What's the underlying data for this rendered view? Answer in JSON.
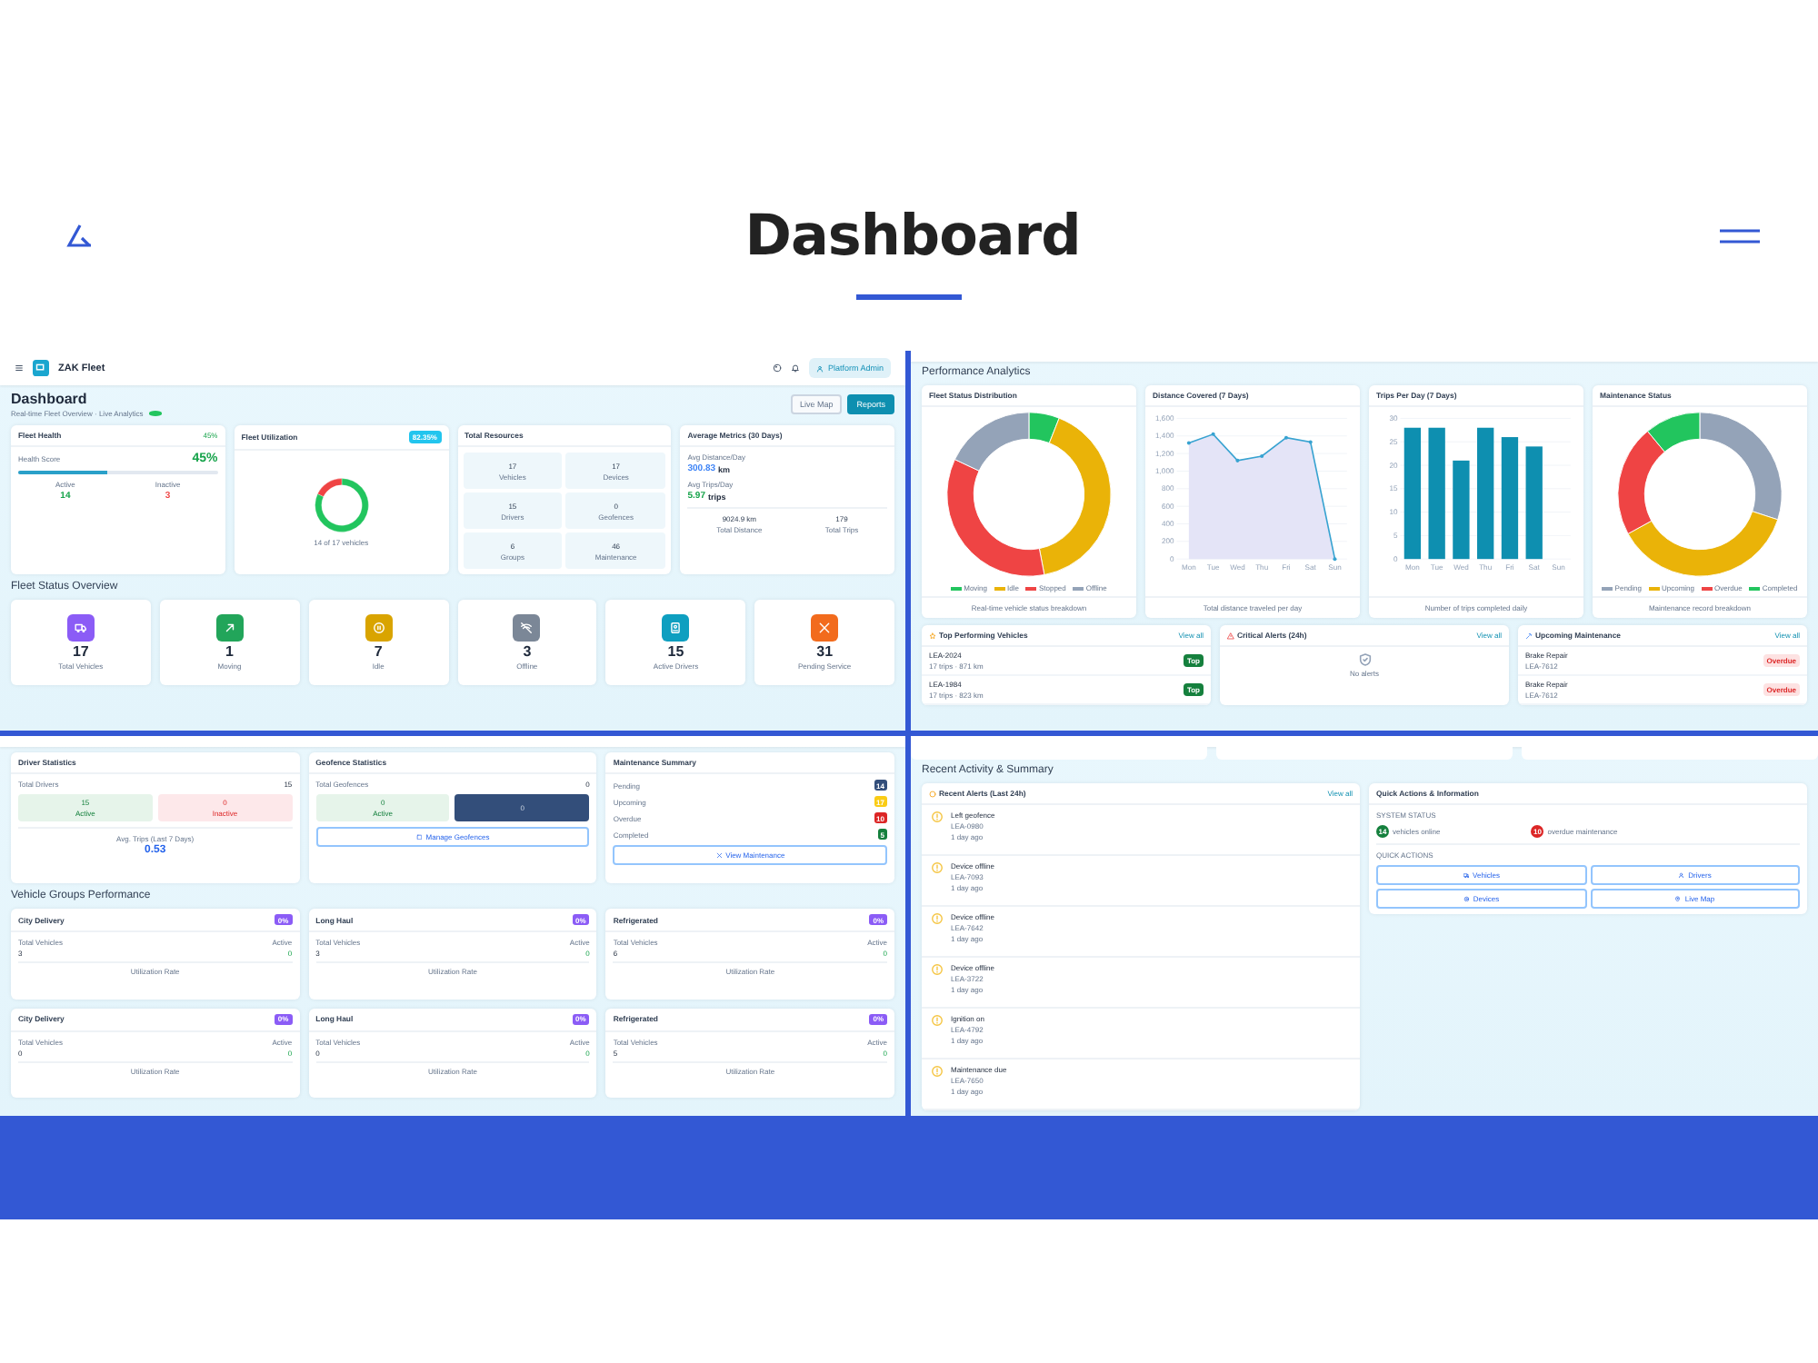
{
  "page": {
    "title": "Dashboard"
  },
  "app": {
    "brand": "ZAK Fleet",
    "user": "Platform Admin"
  },
  "overview": {
    "title": "Dashboard",
    "subtitle": "Real-time Fleet Overview · Live Analytics",
    "buttons": [
      {
        "label": "Live Map",
        "kind": "outline"
      },
      {
        "label": "Reports",
        "kind": "primary"
      }
    ],
    "fleet_health": {
      "title": "Fleet Health",
      "badge": "45%",
      "score_label": "Health Score",
      "score": "45%",
      "level": 0.45,
      "active_label": "Active",
      "active": "14",
      "inactive_label": "Inactive",
      "inactive": "3"
    },
    "utilization": {
      "title": "Fleet Utilization",
      "badge": "82.35%",
      "chart_data": {
        "type": "donut",
        "series": [
          {
            "values": [
              82,
              18
            ]
          }
        ],
        "colors": [
          "#22c55e",
          "#ef4444"
        ]
      },
      "caption": "14 of 17 vehicles"
    },
    "resources": {
      "title": "Total Resources",
      "items": [
        {
          "value": "17",
          "label": "Vehicles"
        },
        {
          "value": "17",
          "label": "Devices"
        },
        {
          "value": "15",
          "label": "Drivers"
        },
        {
          "value": "0",
          "label": "Geofences"
        },
        {
          "value": "6",
          "label": "Groups"
        },
        {
          "value": "46",
          "label": "Maintenance"
        }
      ]
    },
    "metrics": {
      "title": "Average Metrics (30 Days)",
      "items": [
        {
          "label": "Avg Distance/Day",
          "value": "300.83",
          "unit": "km",
          "color": "#3b82f6"
        },
        {
          "label": "Avg Trips/Day",
          "value": "5.97",
          "unit": "trips",
          "color": "#16a34a"
        }
      ],
      "totals": [
        {
          "value": "9024.9 km",
          "label": "Total Distance"
        },
        {
          "value": "179",
          "label": "Total Trips"
        }
      ]
    },
    "status_heading": "Fleet Status Overview",
    "status_cards": [
      {
        "value": "17",
        "label": "Total Vehicles",
        "kind": "truck",
        "color": "#8b5cf6"
      },
      {
        "value": "1",
        "label": "Moving",
        "kind": "arrow",
        "color": "#22a55a"
      },
      {
        "value": "7",
        "label": "Idle",
        "kind": "pause",
        "color": "#d9a400"
      },
      {
        "value": "3",
        "label": "Offline",
        "kind": "wifi",
        "color": "#7b8797"
      },
      {
        "value": "15",
        "label": "Active Drivers",
        "kind": "id",
        "color": "#0e9fc0"
      },
      {
        "value": "31",
        "label": "Pending Service",
        "kind": "tools",
        "color": "#f26b1d"
      }
    ]
  },
  "analytics": {
    "heading": "Performance Analytics",
    "charts": [
      {
        "title": "Fleet Status Distribution",
        "caption": "Real-time vehicle status breakdown",
        "chart_data": {
          "type": "donut",
          "categories": [
            "Moving",
            "Idle",
            "Stopped",
            "Offline"
          ],
          "series": [
            {
              "values": [
                6,
                41,
                35,
                18
              ]
            }
          ],
          "colors": [
            "#22c55e",
            "#eab308",
            "#ef4444",
            "#94a3b8"
          ]
        }
      },
      {
        "title": "Distance Covered (7 Days)",
        "caption": "Total distance traveled per day",
        "chart_data": {
          "type": "area",
          "categories": [
            "Mon",
            "Tue",
            "Wed",
            "Thu",
            "Fri",
            "Sat",
            "Sun"
          ],
          "series": [
            {
              "color": "#38a3d1",
              "values": [
                1320,
                1420,
                1120,
                1170,
                1380,
                1330,
                0
              ]
            }
          ],
          "grid": true,
          "ylim": [
            0,
            1600
          ],
          "yticks": [
            {
              "value": 0,
              "label": "0"
            },
            {
              "value": 200,
              "label": "200"
            },
            {
              "value": 400,
              "label": "400"
            },
            {
              "value": 600,
              "label": "600"
            },
            {
              "value": 800,
              "label": "800"
            },
            {
              "value": 1000,
              "label": "1,000"
            },
            {
              "value": 1200,
              "label": "1,200"
            },
            {
              "value": 1400,
              "label": "1,400"
            },
            {
              "value": 1600,
              "label": "1,600"
            }
          ]
        }
      },
      {
        "title": "Trips Per Day (7 Days)",
        "caption": "Number of trips completed daily",
        "chart_data": {
          "type": "bar",
          "categories": [
            "Mon",
            "Tue",
            "Wed",
            "Thu",
            "Fri",
            "Sat",
            "Sun"
          ],
          "series": [
            {
              "color": "#0e8fb0",
              "values": [
                28,
                28,
                21,
                28,
                26,
                24,
                0
              ]
            }
          ],
          "grid": true,
          "ylim": [
            0,
            30
          ],
          "yticks": [
            0,
            5,
            10,
            15,
            20,
            25,
            30
          ]
        }
      },
      {
        "title": "Maintenance Status",
        "caption": "Maintenance record breakdown",
        "chart_data": {
          "type": "donut",
          "categories": [
            "Pending",
            "Upcoming",
            "Overdue",
            "Completed"
          ],
          "series": [
            {
              "values": [
                30,
                37,
                22,
                11
              ]
            }
          ],
          "colors": [
            "#94a3b8",
            "#eab308",
            "#ef4444",
            "#22c55e"
          ]
        }
      }
    ],
    "lists": [
      {
        "kind": "vehicles",
        "title": "Top Performing Vehicles",
        "link": "View all",
        "rows": [
          {
            "title": "LEA-2024",
            "subtitle": "17 trips · 871 km",
            "badge": "Top"
          },
          {
            "title": "LEA-1984",
            "subtitle": "17 trips · 823 km",
            "badge": "Top"
          }
        ]
      },
      {
        "kind": "empty",
        "title": "Critical Alerts (24h)",
        "link": "View all",
        "empty": "No alerts"
      },
      {
        "kind": "maintenance",
        "title": "Upcoming Maintenance",
        "link": "View all",
        "rows": [
          {
            "title": "Brake Repair",
            "subtitle": "LEA-7612",
            "badge": "Overdue"
          },
          {
            "title": "Brake Repair",
            "subtitle": "LEA-7612",
            "badge": "Overdue"
          }
        ]
      }
    ]
  },
  "statistics": {
    "drivers": {
      "title": "Driver Statistics",
      "total_label": "Total Drivers",
      "total": "15",
      "boxes": [
        {
          "value": "15",
          "label": "Active",
          "kind": "good"
        },
        {
          "value": "0",
          "label": "Inactive",
          "kind": "bad"
        }
      ],
      "avg_label": "Avg. Trips (Last 7 Days)",
      "avg": "0.53"
    },
    "geofences": {
      "title": "Geofence Statistics",
      "total_label": "Total Geofences",
      "total": "0",
      "boxes": [
        {
          "value": "0",
          "label": "Active",
          "kind": "good"
        },
        {
          "value": "0",
          "kind": "dark"
        }
      ],
      "button": "Manage Geofences"
    },
    "maintenance": {
      "title": "Maintenance Summary",
      "rows": [
        {
          "label": "Pending",
          "count": "14",
          "color": "#334e7a"
        },
        {
          "label": "Upcoming",
          "count": "17",
          "color": "#facc15"
        },
        {
          "label": "Overdue",
          "count": "10",
          "color": "#dc2626"
        },
        {
          "label": "Completed",
          "count": "5",
          "color": "#15803d"
        }
      ],
      "button": "View Maintenance"
    },
    "groups_heading": "Vehicle Groups Performance",
    "groups": [
      {
        "name": "City Delivery",
        "badge": "0%",
        "total_label": "Total Vehicles",
        "total": "3",
        "active_label": "Active",
        "active": "0",
        "footer": "Utilization Rate"
      },
      {
        "name": "Long Haul",
        "badge": "0%",
        "total_label": "Total Vehicles",
        "total": "3",
        "active_label": "Active",
        "active": "0",
        "footer": "Utilization Rate"
      },
      {
        "name": "Refrigerated",
        "badge": "0%",
        "total_label": "Total Vehicles",
        "total": "6",
        "active_label": "Active",
        "active": "0",
        "footer": "Utilization Rate"
      },
      {
        "name": "City Delivery",
        "badge": "0%",
        "total_label": "Total Vehicles",
        "total": "0",
        "active_label": "Active",
        "active": "0",
        "footer": "Utilization Rate"
      },
      {
        "name": "Long Haul",
        "badge": "0%",
        "total_label": "Total Vehicles",
        "total": "0",
        "active_label": "Active",
        "active": "0",
        "footer": "Utilization Rate"
      },
      {
        "name": "Refrigerated",
        "badge": "0%",
        "total_label": "Total Vehicles",
        "total": "5",
        "active_label": "Active",
        "active": "0",
        "footer": "Utilization Rate"
      }
    ]
  },
  "activity": {
    "heading": "Recent Activity & Summary",
    "alerts": {
      "title": "Recent Alerts (Last 24h)",
      "link": "View all",
      "items": [
        {
          "title": "Left geofence",
          "vehicle": "LEA-0980",
          "time": "1 day ago"
        },
        {
          "title": "Device offline",
          "vehicle": "LEA-7093",
          "time": "1 day ago"
        },
        {
          "title": "Device offline",
          "vehicle": "LEA-7642",
          "time": "1 day ago"
        },
        {
          "title": "Device offline",
          "vehicle": "LEA-3722",
          "time": "1 day ago"
        },
        {
          "title": "Ignition on",
          "vehicle": "LEA-4792",
          "time": "1 day ago"
        },
        {
          "title": "Maintenance due",
          "vehicle": "LEA-7650",
          "time": "1 day ago"
        }
      ]
    },
    "quick": {
      "title": "Quick Actions & Information",
      "status_label": "SYSTEM STATUS",
      "status": [
        {
          "count": "14",
          "text": "vehicles online",
          "color": "#15803d"
        },
        {
          "count": "10",
          "text": "overdue maintenance",
          "color": "#dc2626"
        }
      ],
      "actions_label": "QUICK ACTIONS",
      "actions": [
        {
          "label": "Vehicles",
          "kind": "truck"
        },
        {
          "label": "Drivers",
          "kind": "user"
        },
        {
          "label": "Devices",
          "kind": "gear"
        },
        {
          "label": "Live Map",
          "kind": "pin"
        }
      ]
    }
  }
}
